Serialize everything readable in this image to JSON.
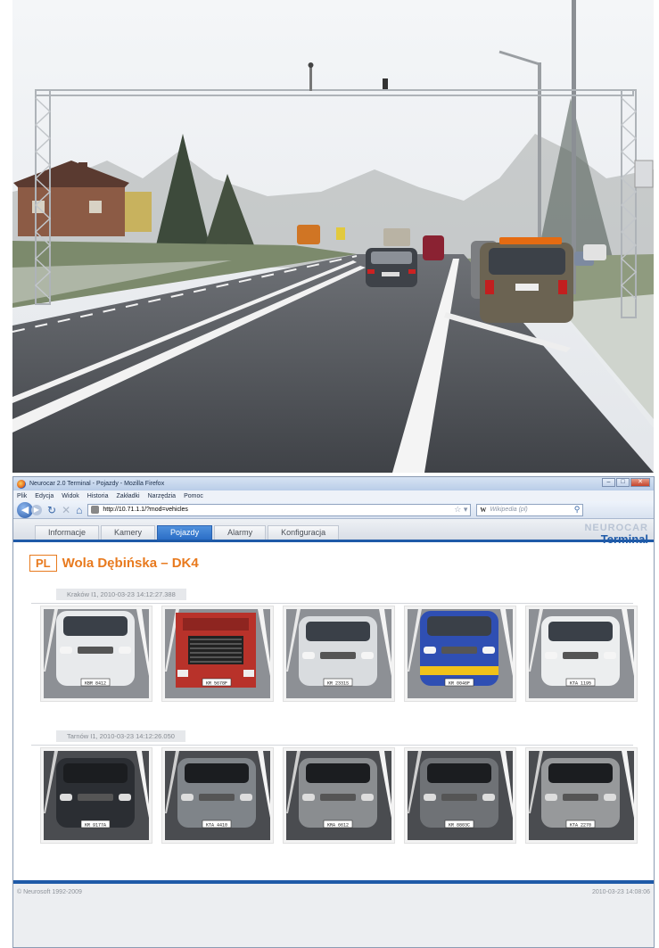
{
  "browser": {
    "window_title": "Neurocar 2.0 Terminal - Pojazdy - Mozilla Firefox",
    "menu": [
      "Plik",
      "Edycja",
      "Widok",
      "Historia",
      "Zakładki",
      "Narzędzia",
      "Pomoc"
    ],
    "url": "http://10.71.1.1/?mod=vehicles",
    "search_placeholder": "Wikipedia (pl)",
    "search_engine": "W"
  },
  "app": {
    "tabs": [
      "Informacje",
      "Kamery",
      "Pojazdy",
      "Alarmy",
      "Konfiguracja"
    ],
    "active_tab": "Pojazdy",
    "brand_top": "NEUROCAR",
    "brand_bottom": "Terminal",
    "country_code": "PL",
    "site_name": "Wola Dębińska – DK4",
    "groups": [
      {
        "label": "Kraków I1, 2010-03-23 14:12:27.388",
        "vehicles": [
          {
            "type": "van",
            "color": "#e8eaec",
            "plate": "KBR 8412"
          },
          {
            "type": "truck",
            "color": "#b8322a",
            "plate": "KR 5678F"
          },
          {
            "type": "car",
            "color": "#d9dcdf",
            "plate": "KR 2331S"
          },
          {
            "type": "van",
            "color": "#2f4fb3",
            "plate": "KR 0046F"
          },
          {
            "type": "car",
            "color": "#eceeef",
            "plate": "KTA 1195"
          }
        ]
      },
      {
        "label": "Tarnów I1, 2010-03-23 14:12:26.050",
        "vehicles": [
          {
            "type": "car",
            "color": "#2b2e33",
            "plate": "KR 9177A"
          },
          {
            "type": "car",
            "color": "#7f8489",
            "plate": "KTA 4410"
          },
          {
            "type": "car",
            "color": "#8a8d90",
            "plate": "KRA 6612"
          },
          {
            "type": "car",
            "color": "#6f7276",
            "plate": "KR 8803C"
          },
          {
            "type": "car",
            "color": "#97999b",
            "plate": "KTA 2270"
          }
        ]
      }
    ],
    "footer_copyright": "© Neurosoft 1992-2009",
    "footer_datetime": "2010-03-23 14:08:06"
  }
}
